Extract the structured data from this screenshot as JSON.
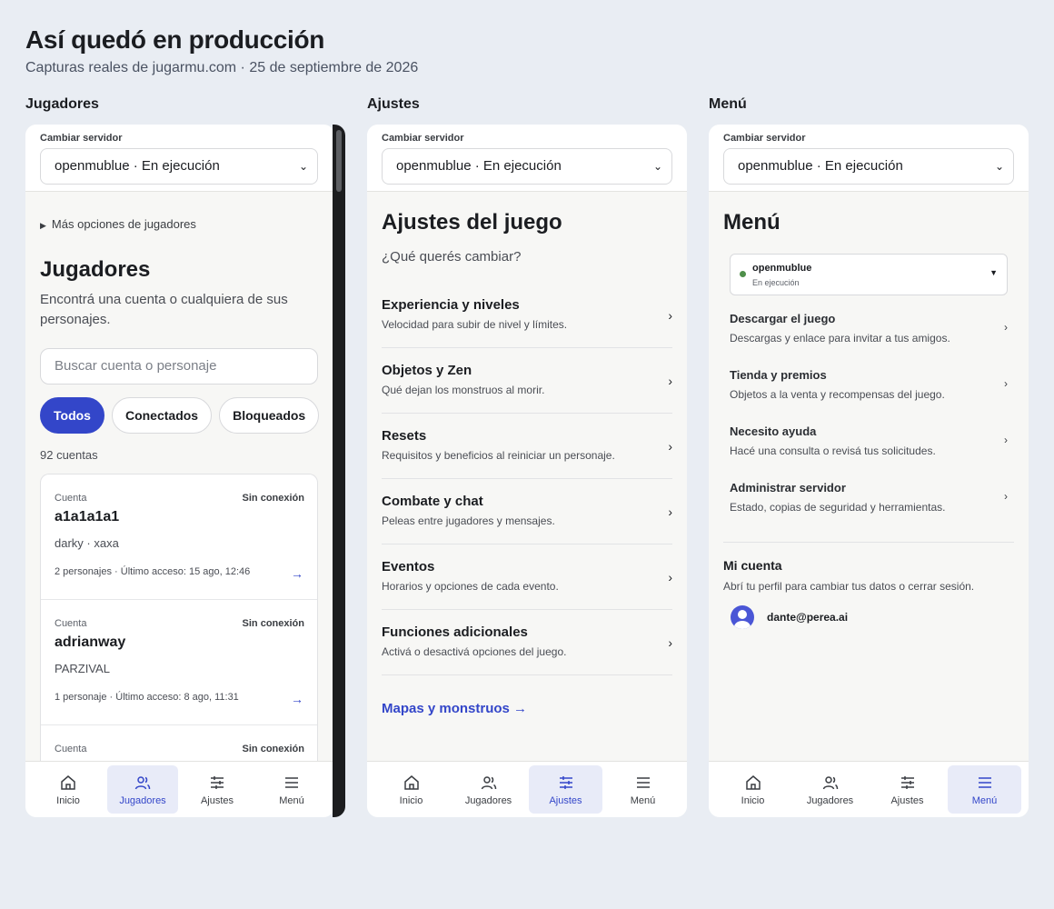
{
  "header": {
    "title": "Así quedó en producción",
    "subtitle": "Capturas reales de jugarmu.com · 25 de septiembre de 2026"
  },
  "columns": {
    "jugadores": "Jugadores",
    "ajustes": "Ajustes",
    "menu": "Menú"
  },
  "server_switch": {
    "label": "Cambiar servidor",
    "value": "openmublue · En ejecución"
  },
  "bottom_nav": {
    "inicio": "Inicio",
    "jugadores": "Jugadores",
    "ajustes": "Ajustes",
    "menu": "Menú"
  },
  "jugadores_screen": {
    "more_options": "Más opciones de jugadores",
    "title": "Jugadores",
    "description": "Encontrá una cuenta o cualquiera de sus personajes.",
    "search_placeholder": "Buscar cuenta o personaje",
    "filters": [
      "Todos",
      "Conectados",
      "Bloqueados"
    ],
    "count": "92 cuentas",
    "accounts": [
      {
        "kicker": "Cuenta",
        "status": "Sin conexión",
        "name": "a1a1a1a1",
        "characters": "darky · xaxa",
        "meta": "2 personajes · Último acceso: 15 ago, 12:46"
      },
      {
        "kicker": "Cuenta",
        "status": "Sin conexión",
        "name": "adrianway",
        "characters": "PARZIVAL",
        "meta": "1 personaje · Último acceso: 8 ago, 11:31"
      },
      {
        "kicker": "Cuenta",
        "status": "Sin conexión",
        "name": "",
        "characters": "",
        "meta": ""
      }
    ]
  },
  "ajustes_screen": {
    "title": "Ajustes del juego",
    "subtitle": "¿Qué querés cambiar?",
    "items": [
      {
        "title": "Experiencia y niveles",
        "desc": "Velocidad para subir de nivel y límites."
      },
      {
        "title": "Objetos y Zen",
        "desc": "Qué dejan los monstruos al morir."
      },
      {
        "title": "Resets",
        "desc": "Requisitos y beneficios al reiniciar un personaje."
      },
      {
        "title": "Combate y chat",
        "desc": "Peleas entre jugadores y mensajes."
      },
      {
        "title": "Eventos",
        "desc": "Horarios y opciones de cada evento."
      },
      {
        "title": "Funciones adicionales",
        "desc": "Activá o desactivá opciones del juego."
      }
    ],
    "link": "Mapas y monstruos →"
  },
  "menu_screen": {
    "title": "Menú",
    "server": {
      "name": "openmublue",
      "state": "En ejecución"
    },
    "items": [
      {
        "title": "Descargar el juego",
        "desc": "Descargas y enlace para invitar a tus amigos."
      },
      {
        "title": "Tienda y premios",
        "desc": "Objetos a la venta y recompensas del juego."
      },
      {
        "title": "Necesito ayuda",
        "desc": "Hacé una consulta o revisá tus solicitudes."
      },
      {
        "title": "Administrar servidor",
        "desc": "Estado, copias de seguridad y herramientas."
      }
    ],
    "account_title": "Mi cuenta",
    "account_desc": "Abrí tu perfil para cambiar tus datos o cerrar sesión.",
    "email": "dante@perea.ai"
  },
  "colors": {
    "accent": "#3346c9",
    "active_nav_bg": "#e8ebf8",
    "page_bg": "#e9edf3",
    "status_green": "#4e8f4a"
  }
}
